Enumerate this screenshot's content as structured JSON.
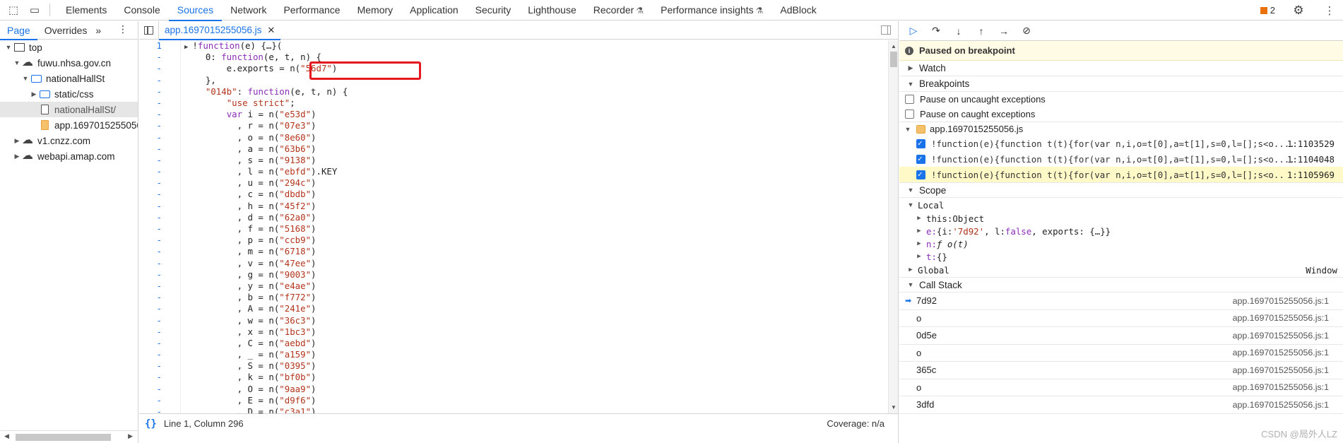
{
  "top_tabs": [
    "Elements",
    "Console",
    "Sources",
    "Network",
    "Performance",
    "Memory",
    "Application",
    "Security",
    "Lighthouse",
    "Recorder",
    "Performance insights",
    "AdBlock"
  ],
  "active_top_tab": "Sources",
  "issues_count": "2",
  "navigator": {
    "tabs": [
      "Page",
      "Overrides"
    ],
    "tree": [
      {
        "label": "top",
        "depth": 0,
        "twisty": "open",
        "icon": "frame-icon"
      },
      {
        "label": "fuwu.nhsa.gov.cn",
        "depth": 1,
        "twisty": "open",
        "icon": "cloud-icon"
      },
      {
        "label": "nationalHallSt",
        "depth": 2,
        "twisty": "open",
        "icon": "folder-icon"
      },
      {
        "label": "static/css",
        "depth": 3,
        "twisty": "closed",
        "icon": "folder-icon"
      },
      {
        "label": "nationalHallSt/",
        "depth": 3,
        "twisty": "none",
        "icon": "file-icon",
        "selected": true
      },
      {
        "label": "app.1697015255056.js",
        "depth": 3,
        "twisty": "none",
        "icon": "js-file-icon"
      },
      {
        "label": "v1.cnzz.com",
        "depth": 1,
        "twisty": "closed",
        "icon": "cloud-icon"
      },
      {
        "label": "webapi.amap.com",
        "depth": 1,
        "twisty": "closed",
        "icon": "cloud-icon"
      }
    ]
  },
  "editor": {
    "file_tab": "app.1697015255056.js",
    "status_position": "Line 1, Column 296",
    "coverage": "Coverage: n/a",
    "lines": [
      {
        "n": "1",
        "t": "!function(e) {…}(",
        "fold": true
      },
      {
        "n": "-",
        "t": "    0: function(e, t, n) {"
      },
      {
        "n": "-",
        "t": "        e.exports = n(\"56d7\")"
      },
      {
        "n": "-",
        "t": "    },"
      },
      {
        "n": "-",
        "t": "    \"014b\": function(e, t, n) {"
      },
      {
        "n": "-",
        "t": "        \"use strict\";"
      },
      {
        "n": "-",
        "t": "        var i = n(\"e53d\")"
      },
      {
        "n": "-",
        "t": "          , r = n(\"07e3\")"
      },
      {
        "n": "-",
        "t": "          , o = n(\"8e60\")"
      },
      {
        "n": "-",
        "t": "          , a = n(\"63b6\")"
      },
      {
        "n": "-",
        "t": "          , s = n(\"9138\")"
      },
      {
        "n": "-",
        "t": "          , l = n(\"ebfd\").KEY"
      },
      {
        "n": "-",
        "t": "          , u = n(\"294c\")"
      },
      {
        "n": "-",
        "t": "          , c = n(\"dbdb\")"
      },
      {
        "n": "-",
        "t": "          , h = n(\"45f2\")"
      },
      {
        "n": "-",
        "t": "          , d = n(\"62a0\")"
      },
      {
        "n": "-",
        "t": "          , f = n(\"5168\")"
      },
      {
        "n": "-",
        "t": "          , p = n(\"ccb9\")"
      },
      {
        "n": "-",
        "t": "          , m = n(\"6718\")"
      },
      {
        "n": "-",
        "t": "          , v = n(\"47ee\")"
      },
      {
        "n": "-",
        "t": "          , g = n(\"9003\")"
      },
      {
        "n": "-",
        "t": "          , y = n(\"e4ae\")"
      },
      {
        "n": "-",
        "t": "          , b = n(\"f772\")"
      },
      {
        "n": "-",
        "t": "          , A = n(\"241e\")"
      },
      {
        "n": "-",
        "t": "          , w = n(\"36c3\")"
      },
      {
        "n": "-",
        "t": "          , x = n(\"1bc3\")"
      },
      {
        "n": "-",
        "t": "          , C = n(\"aebd\")"
      },
      {
        "n": "-",
        "t": "          , _ = n(\"a159\")"
      },
      {
        "n": "-",
        "t": "          , S = n(\"0395\")"
      },
      {
        "n": "-",
        "t": "          , k = n(\"bf0b\")"
      },
      {
        "n": "-",
        "t": "          , O = n(\"9aa9\")"
      },
      {
        "n": "-",
        "t": "          , E = n(\"d9f6\")"
      },
      {
        "n": "-",
        "t": "          , D = n(\"c3a1\")"
      }
    ]
  },
  "debugger": {
    "paused_message": "Paused on breakpoint",
    "sections": {
      "watch": "Watch",
      "breakpoints": "Breakpoints",
      "scope": "Scope",
      "call_stack": "Call Stack"
    },
    "pause_uncaught": "Pause on uncaught exceptions",
    "pause_caught": "Pause on caught exceptions",
    "bp_file": "app.1697015255056.js",
    "breakpoints": [
      {
        "code": "!function(e){function t(t){for(var n,i,o=t[0],a=t[1],s=0,l=[];s<o....",
        "loc": "1:1103529",
        "active": false
      },
      {
        "code": "!function(e){function t(t){for(var n,i,o=t[0],a=t[1],s=0,l=[];s<o....",
        "loc": "1:1104048",
        "active": false
      },
      {
        "code": "!function(e){function t(t){for(var n,i,o=t[0],a=t[1],s=0,l=[];s<o....",
        "loc": "1:1105969",
        "active": true
      }
    ],
    "scope": {
      "local_label": "Local",
      "this_label": "this: ",
      "this_val": "Object",
      "e_label": "e: ",
      "e_val_pre": "{i: ",
      "e_val_str": "'7d92'",
      "e_val_mid": ", l: ",
      "e_val_kw": "false",
      "e_val_post": ", exports: {…}}",
      "n_label": "n: ",
      "n_val": "ƒ o(t)",
      "t_label": "t: ",
      "t_val": "{}",
      "global_label": "Global",
      "global_val": "Window"
    },
    "call_stack": [
      {
        "fn": "7d92",
        "loc": "app.1697015255056.js:1",
        "current": true
      },
      {
        "fn": "o",
        "loc": "app.1697015255056.js:1"
      },
      {
        "fn": "0d5e",
        "loc": "app.1697015255056.js:1"
      },
      {
        "fn": "o",
        "loc": "app.1697015255056.js:1"
      },
      {
        "fn": "365c",
        "loc": "app.1697015255056.js:1"
      },
      {
        "fn": "o",
        "loc": "app.1697015255056.js:1"
      },
      {
        "fn": "3dfd",
        "loc": "app.1697015255056.js:1"
      }
    ],
    "watermark": "CSDN @局外人LZ"
  },
  "colors": {
    "accent": "#1a73e8",
    "highlight_red": "#e6181f",
    "paused_bg": "#fffbe5"
  }
}
